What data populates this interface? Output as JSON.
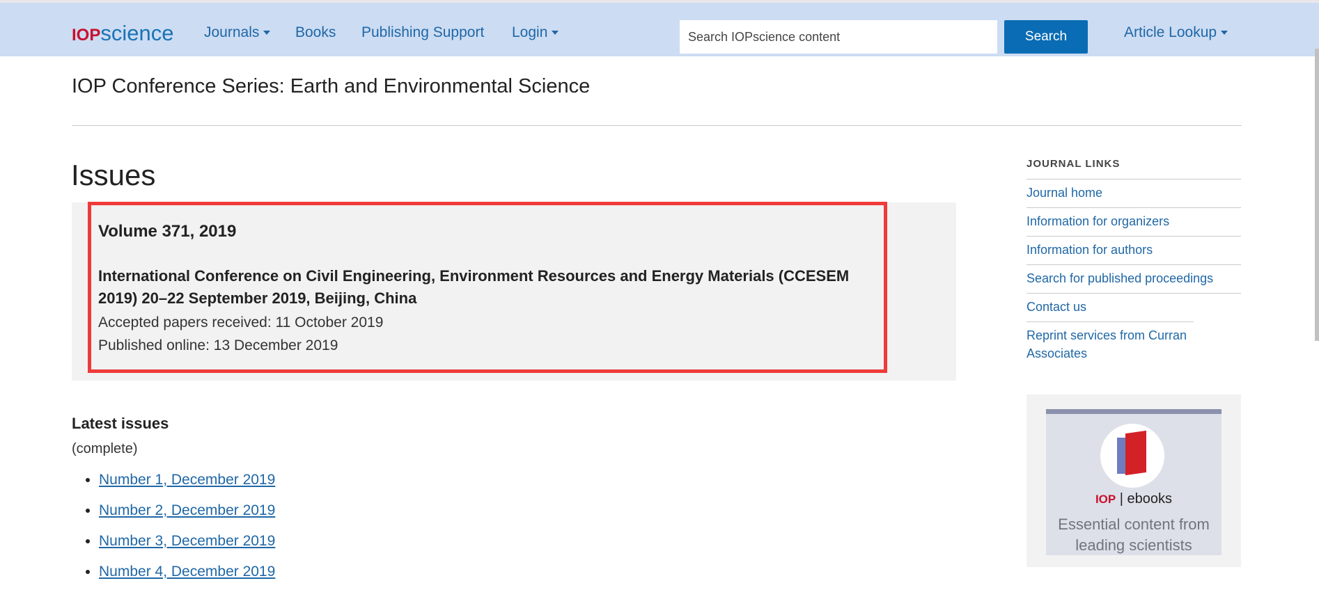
{
  "header": {
    "logo_iop": "IOP",
    "logo_science": "science",
    "nav": [
      {
        "label": "Journals",
        "dropdown": true
      },
      {
        "label": "Books",
        "dropdown": false
      },
      {
        "label": "Publishing Support",
        "dropdown": false
      },
      {
        "label": "Login",
        "dropdown": true
      }
    ],
    "search_placeholder": "Search IOPscience content",
    "search_button": "Search",
    "article_lookup": "Article Lookup"
  },
  "journal_title": "IOP Conference Series: Earth and Environmental Science",
  "main": {
    "heading": "Issues",
    "issue": {
      "volume": "Volume 371, 2019",
      "conference": "International Conference on Civil Engineering, Environment Resources and Energy Materials (CCESEM 2019) 20–22 September 2019, Beijing, China",
      "accepted": "Accepted papers received: 11 October 2019",
      "published": "Published online: 13 December 2019"
    },
    "latest_heading": "Latest issues",
    "latest_status": "(complete)",
    "latest_items": [
      "Number 1, December 2019",
      "Number 2, December 2019",
      "Number 3, December 2019",
      "Number 4, December 2019"
    ]
  },
  "sidebar": {
    "heading": "JOURNAL LINKS",
    "links": [
      "Journal home",
      "Information for organizers",
      "Information for authors",
      "Search for published proceedings",
      "Contact us",
      "Reprint services from Curran Associates"
    ],
    "ad": {
      "brand_iop": "IOP",
      "brand_sep": " | ",
      "brand_ebooks": "ebooks",
      "tagline": "Essential content from leading scientists"
    }
  }
}
